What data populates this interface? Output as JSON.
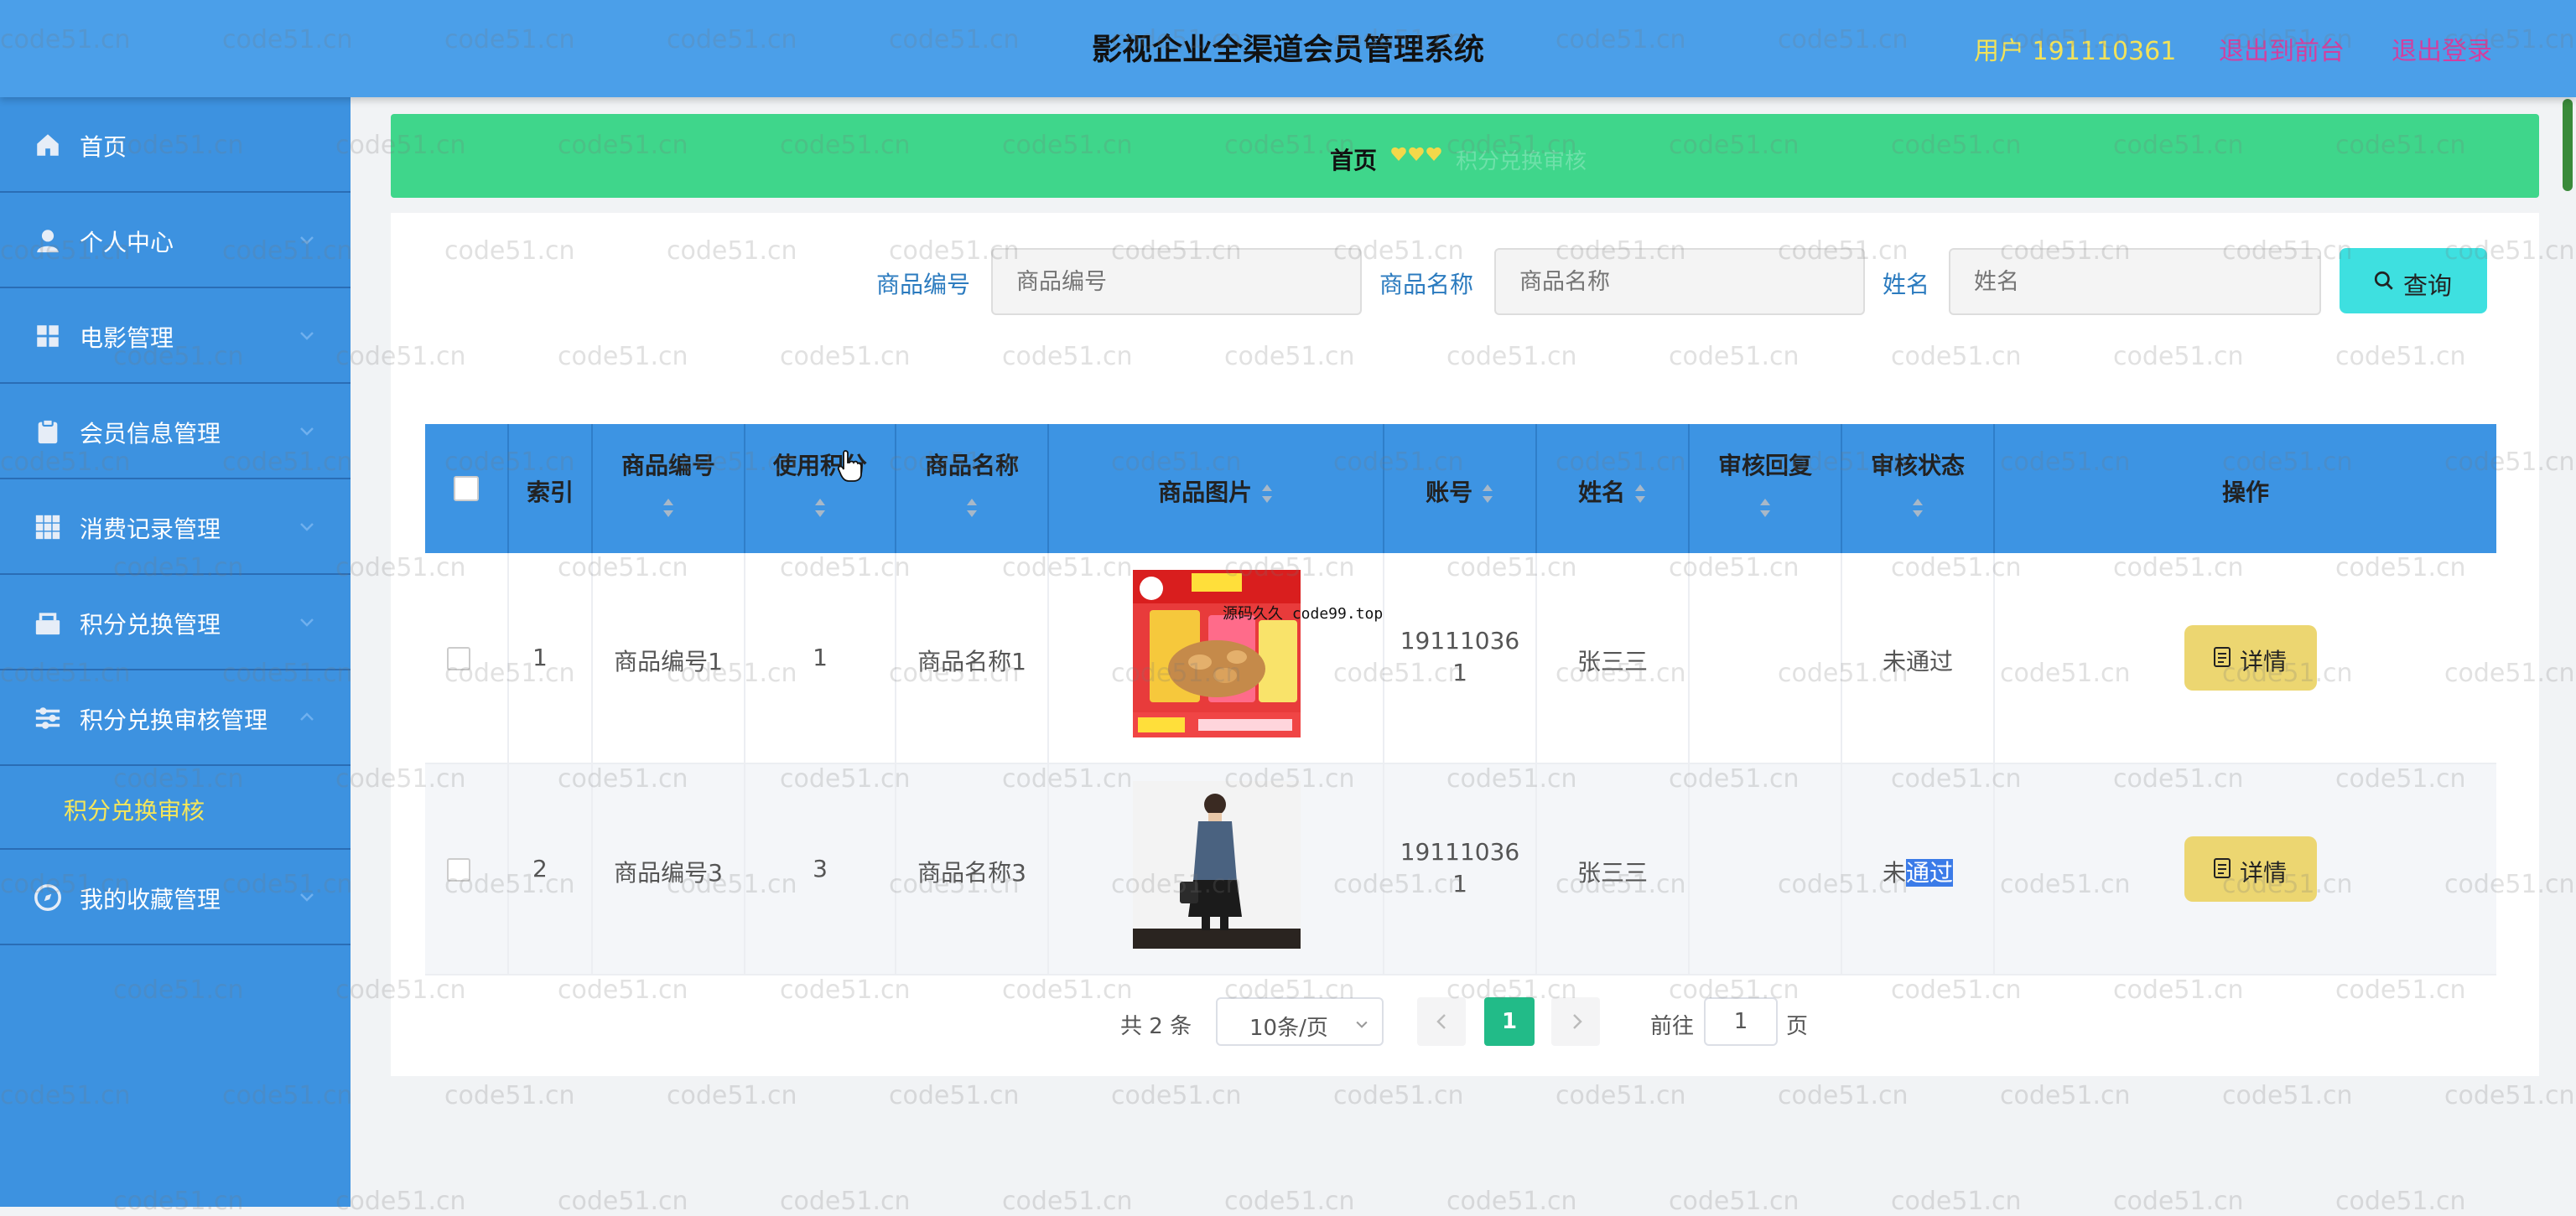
{
  "header": {
    "title": "影视企业全渠道会员管理系统",
    "user": "用户 191110361",
    "back_front": "退出到前台",
    "logout": "退出登录"
  },
  "sidebar": {
    "items": [
      {
        "label": "首页",
        "icon": "home-icon"
      },
      {
        "label": "个人中心",
        "icon": "user-icon"
      },
      {
        "label": "电影管理",
        "icon": "grid-icon"
      },
      {
        "label": "会员信息管理",
        "icon": "clipboard-icon"
      },
      {
        "label": "消费记录管理",
        "icon": "apps-icon"
      },
      {
        "label": "积分兑换管理",
        "icon": "exchange-icon"
      },
      {
        "label": "积分兑换审核管理",
        "icon": "sliders-icon"
      },
      {
        "label": "我的收藏管理",
        "icon": "compass-icon"
      }
    ],
    "submenu": {
      "label": "积分兑换审核"
    }
  },
  "breadcrumb": {
    "home": "首页",
    "current": "积分兑换审核"
  },
  "search": {
    "code_label": "商品编号",
    "code_placeholder": "商品编号",
    "name_label": "商品名称",
    "name_placeholder": "商品名称",
    "person_label": "姓名",
    "person_placeholder": "姓名",
    "button": "查询"
  },
  "table": {
    "headers": [
      "索引",
      "商品编号",
      "使用积分",
      "商品名称",
      "商品图片",
      "账号",
      "姓名",
      "审核回复",
      "审核状态",
      "操作"
    ],
    "rows": [
      {
        "index": "1",
        "code": "商品编号1",
        "points": "1",
        "name": "商品名称1",
        "account_l1": "19111036",
        "account_l2": "1",
        "person": "张三三",
        "reply": "",
        "status": "未通过",
        "status_a": "未通过",
        "status_b": "",
        "action": "详情"
      },
      {
        "index": "2",
        "code": "商品编号3",
        "points": "3",
        "name": "商品名称3",
        "account_l1": "19111036",
        "account_l2": "1",
        "person": "张三三",
        "reply": "",
        "status": "未通过",
        "status_a": "未",
        "status_b": "通过",
        "action": "详情"
      }
    ]
  },
  "pagination": {
    "total": "共 2 条",
    "page_size": "10条/页",
    "current": "1",
    "goto_label": "前往",
    "goto_value": "1",
    "page_unit": "页"
  },
  "image_overlay_text": "源码久久 code99.top",
  "watermark": "code51.cn",
  "colors": {
    "header_bg": "#4b9fe9",
    "sidebar_bg": "#3d92e0",
    "breadcrumb_bg": "#3fd68b",
    "table_header_bg": "#3d94e3",
    "search_button": "#3ee0e0",
    "detail_button": "#ecd671",
    "pager_active": "#22bb88"
  }
}
